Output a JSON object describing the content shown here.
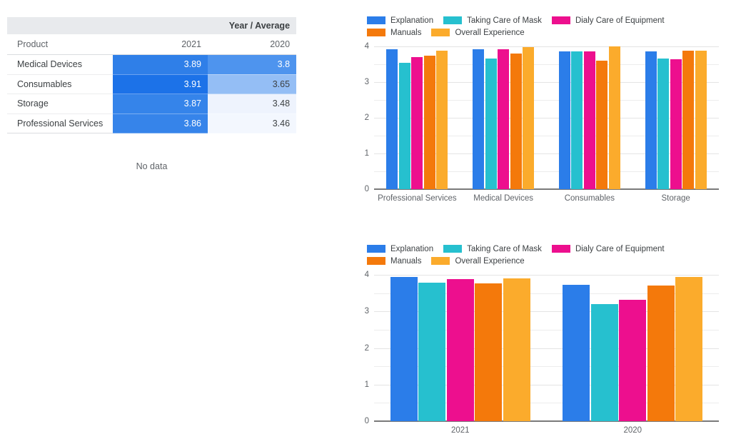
{
  "table": {
    "group_header": "Year / Average",
    "columns": [
      "Product",
      "2021",
      "2020"
    ],
    "rows": [
      {
        "product": "Medical Devices",
        "v2021": "3.89",
        "v2020": "3.8"
      },
      {
        "product": "Consumables",
        "v2021": "3.91",
        "v2020": "3.65"
      },
      {
        "product": "Storage",
        "v2021": "3.87",
        "v2020": "3.48"
      },
      {
        "product": "Professional Services",
        "v2021": "3.86",
        "v2020": "3.46"
      }
    ],
    "cell_colors_2021": [
      "#2f7fe8",
      "#1c72e8",
      "#3584ea",
      "#3684ea"
    ],
    "cell_text_colors_2021": [
      "#ffffff",
      "#ffffff",
      "#ffffff",
      "#ffffff"
    ],
    "cell_colors_2020": [
      "#4e94ee",
      "#94bef5",
      "#eef3fd",
      "#f3f7fe"
    ],
    "cell_text_colors_2020": [
      "#ffffff",
      "#3c4043",
      "#3c4043",
      "#3c4043"
    ],
    "no_data_text": "No data"
  },
  "series_colors": {
    "Explanation": "#2b7de9",
    "Taking Care of Mask": "#26c0cf",
    "Dialy Care of Equipment": "#ed0f8e",
    "Manuals": "#f4790b",
    "Overall Experience": "#fbab2c"
  },
  "chart_data": [
    {
      "id": "chart-by-product",
      "type": "bar",
      "title": "",
      "xlabel": "",
      "ylabel": "",
      "ylim": [
        0,
        4
      ],
      "yticks": [
        0,
        1,
        2,
        3,
        4
      ],
      "ytick_labels": [
        "0",
        "1",
        "2",
        "3",
        "4"
      ],
      "minor_gridlines": [
        0.5,
        1.5,
        2.5,
        3.5
      ],
      "grid": true,
      "legend_position": "top-left",
      "categories": [
        "Professional Services",
        "Medical Devices",
        "Consumables",
        "Storage"
      ],
      "series": [
        {
          "name": "Explanation",
          "color": "#2b7de9",
          "values": [
            3.93,
            3.92,
            3.86,
            3.86
          ]
        },
        {
          "name": "Taking Care of Mask",
          "color": "#26c0cf",
          "values": [
            3.55,
            3.66,
            3.87,
            3.67
          ]
        },
        {
          "name": "Dialy Care of Equipment",
          "color": "#ed0f8e",
          "values": [
            3.71,
            3.93,
            3.87,
            3.64
          ]
        },
        {
          "name": "Manuals",
          "color": "#f4790b",
          "values": [
            3.74,
            3.8,
            3.6,
            3.88
          ]
        },
        {
          "name": "Overall Experience",
          "color": "#fbab2c",
          "values": [
            3.88,
            3.99,
            4.0,
            3.88
          ]
        }
      ]
    },
    {
      "id": "chart-by-year",
      "type": "bar",
      "title": "",
      "xlabel": "",
      "ylabel": "",
      "ylim": [
        0,
        4
      ],
      "yticks": [
        0,
        1,
        2,
        3,
        4
      ],
      "ytick_labels": [
        "0",
        "1",
        "2",
        "3",
        "4"
      ],
      "minor_gridlines": [
        0.5,
        1.5,
        2.5,
        3.5
      ],
      "grid": true,
      "legend_position": "top-left",
      "categories": [
        "2021",
        "2020"
      ],
      "series": [
        {
          "name": "Explanation",
          "color": "#2b7de9",
          "values": [
            3.95,
            3.72
          ]
        },
        {
          "name": "Taking Care of Mask",
          "color": "#26c0cf",
          "values": [
            3.78,
            3.2
          ]
        },
        {
          "name": "Dialy Care of Equipment",
          "color": "#ed0f8e",
          "values": [
            3.88,
            3.32
          ]
        },
        {
          "name": "Manuals",
          "color": "#f4790b",
          "values": [
            3.77,
            3.7
          ]
        },
        {
          "name": "Overall Experience",
          "color": "#fbab2c",
          "values": [
            3.91,
            3.95
          ]
        }
      ]
    }
  ]
}
